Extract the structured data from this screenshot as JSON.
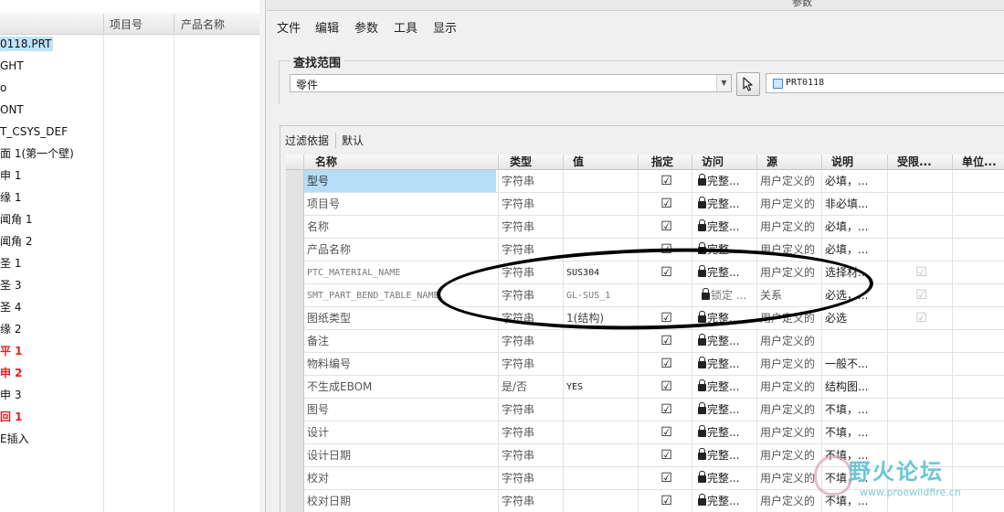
{
  "left_tree": {
    "columns": [
      "项目号",
      "产品名称"
    ],
    "items": [
      {
        "label": "0118.PRT",
        "selected": true,
        "red": false
      },
      {
        "label": "GHT",
        "selected": false,
        "red": false
      },
      {
        "label": "o",
        "selected": false,
        "red": false
      },
      {
        "label": "ONT",
        "selected": false,
        "red": false
      },
      {
        "label": "T_CSYS_DEF",
        "selected": false,
        "red": false
      },
      {
        "label": "面 1(第一个壁)",
        "selected": false,
        "red": false
      },
      {
        "label": "申 1",
        "selected": false,
        "red": false
      },
      {
        "label": "缘 1",
        "selected": false,
        "red": false
      },
      {
        "label": "闻角 1",
        "selected": false,
        "red": false
      },
      {
        "label": "闻角 2",
        "selected": false,
        "red": false
      },
      {
        "label": "圣 1",
        "selected": false,
        "red": false
      },
      {
        "label": "圣 3",
        "selected": false,
        "red": false
      },
      {
        "label": "圣 4",
        "selected": false,
        "red": false
      },
      {
        "label": "缘 2",
        "selected": false,
        "red": false
      },
      {
        "label": "平 1",
        "selected": false,
        "red": true
      },
      {
        "label": "申 2",
        "selected": false,
        "red": true
      },
      {
        "label": "申 3",
        "selected": false,
        "red": false
      },
      {
        "label": "回 1",
        "selected": false,
        "red": true
      },
      {
        "label": "E插入",
        "selected": false,
        "red": false
      }
    ]
  },
  "dialog": {
    "title": "参数",
    "menu": [
      "文件",
      "编辑",
      "参数",
      "工具",
      "显示"
    ],
    "search_scope": {
      "legend": "查找范围",
      "scope_value": "零件",
      "part_value": "PRT0118"
    },
    "filter": {
      "label": "过滤依据",
      "value": "默认"
    }
  },
  "table": {
    "headers": [
      "名称",
      "类型",
      "值",
      "指定",
      "访问",
      "源",
      "说明",
      "受限...",
      "单位..."
    ],
    "rows": [
      {
        "name": "型号",
        "type": "字符串",
        "value": "",
        "designated": true,
        "access": "完整...",
        "source": "用户定义的",
        "desc": "必填，...",
        "restricted": "",
        "unit": "",
        "selected": true,
        "mono": false,
        "locked_plain": false
      },
      {
        "name": "项目号",
        "type": "字符串",
        "value": "",
        "designated": true,
        "access": "完整...",
        "source": "用户定义的",
        "desc": "非必填...",
        "restricted": "",
        "unit": "",
        "selected": false,
        "mono": false,
        "locked_plain": false
      },
      {
        "name": "名称",
        "type": "字符串",
        "value": "",
        "designated": true,
        "access": "完整...",
        "source": "用户定义的",
        "desc": "必填，...",
        "restricted": "",
        "unit": "",
        "selected": false,
        "mono": false,
        "locked_plain": false
      },
      {
        "name": "产品名称",
        "type": "字符串",
        "value": "",
        "designated": true,
        "access": "完整...",
        "source": "用户定义的",
        "desc": "必填，...",
        "restricted": "",
        "unit": "",
        "selected": false,
        "mono": false,
        "locked_plain": false
      },
      {
        "name": "PTC_MATERIAL_NAME",
        "type": "字符串",
        "value": "SUS304",
        "designated": true,
        "access": "完整...",
        "source": "用户定义的",
        "desc": "选择材...",
        "restricted": "check",
        "unit": "",
        "selected": false,
        "mono": true,
        "locked_plain": false
      },
      {
        "name": "SMT_PART_BEND_TABLE_NAME",
        "type": "字符串",
        "value": "GL-SUS_1",
        "designated": false,
        "access": "锁定 ...",
        "source": "关系",
        "desc": "必选，...",
        "restricted": "check",
        "unit": "",
        "selected": false,
        "mono": true,
        "locked_plain": true
      },
      {
        "name": "图纸类型",
        "type": "字符串",
        "value": "1(结构)",
        "designated": true,
        "access": "完整...",
        "source": "用户定义的",
        "desc": "必选",
        "restricted": "check",
        "unit": "",
        "selected": false,
        "mono": false,
        "locked_plain": false
      },
      {
        "name": "备注",
        "type": "字符串",
        "value": "",
        "designated": true,
        "access": "完整...",
        "source": "用户定义的",
        "desc": "",
        "restricted": "",
        "unit": "",
        "selected": false,
        "mono": false,
        "locked_plain": false
      },
      {
        "name": "物料编号",
        "type": "字符串",
        "value": "",
        "designated": true,
        "access": "完整...",
        "source": "用户定义的",
        "desc": "一般不...",
        "restricted": "",
        "unit": "",
        "selected": false,
        "mono": false,
        "locked_plain": false
      },
      {
        "name": "不生成EBOM",
        "type": "是/否",
        "value": "YES",
        "designated": true,
        "access": "完整...",
        "source": "用户定义的",
        "desc": "结构图...",
        "restricted": "",
        "unit": "",
        "selected": false,
        "mono": false,
        "locked_plain": false
      },
      {
        "name": "图号",
        "type": "字符串",
        "value": "",
        "designated": true,
        "access": "完整...",
        "source": "用户定义的",
        "desc": "不填，...",
        "restricted": "",
        "unit": "",
        "selected": false,
        "mono": false,
        "locked_plain": false
      },
      {
        "name": "设计",
        "type": "字符串",
        "value": "",
        "designated": true,
        "access": "完整...",
        "source": "用户定义的",
        "desc": "不填，...",
        "restricted": "",
        "unit": "",
        "selected": false,
        "mono": false,
        "locked_plain": false
      },
      {
        "name": "设计日期",
        "type": "字符串",
        "value": "",
        "designated": true,
        "access": "完整...",
        "source": "用户定义的",
        "desc": "不填，...",
        "restricted": "",
        "unit": "",
        "selected": false,
        "mono": false,
        "locked_plain": false
      },
      {
        "name": "校对",
        "type": "字符串",
        "value": "",
        "designated": true,
        "access": "完整...",
        "source": "用户定义的",
        "desc": "不填，...",
        "restricted": "",
        "unit": "",
        "selected": false,
        "mono": false,
        "locked_plain": false
      },
      {
        "name": "校对日期",
        "type": "字符串",
        "value": "",
        "designated": true,
        "access": "完整...",
        "source": "用户定义的",
        "desc": "不填，...",
        "restricted": "",
        "unit": "",
        "selected": false,
        "mono": false,
        "locked_plain": false
      }
    ]
  },
  "watermark": {
    "cn": "野火论坛",
    "url": "www.proewildfire.cn"
  },
  "colors": {
    "selection": "#b5def6",
    "red_item": "#e02020",
    "watermark": "#6cc6d8"
  }
}
